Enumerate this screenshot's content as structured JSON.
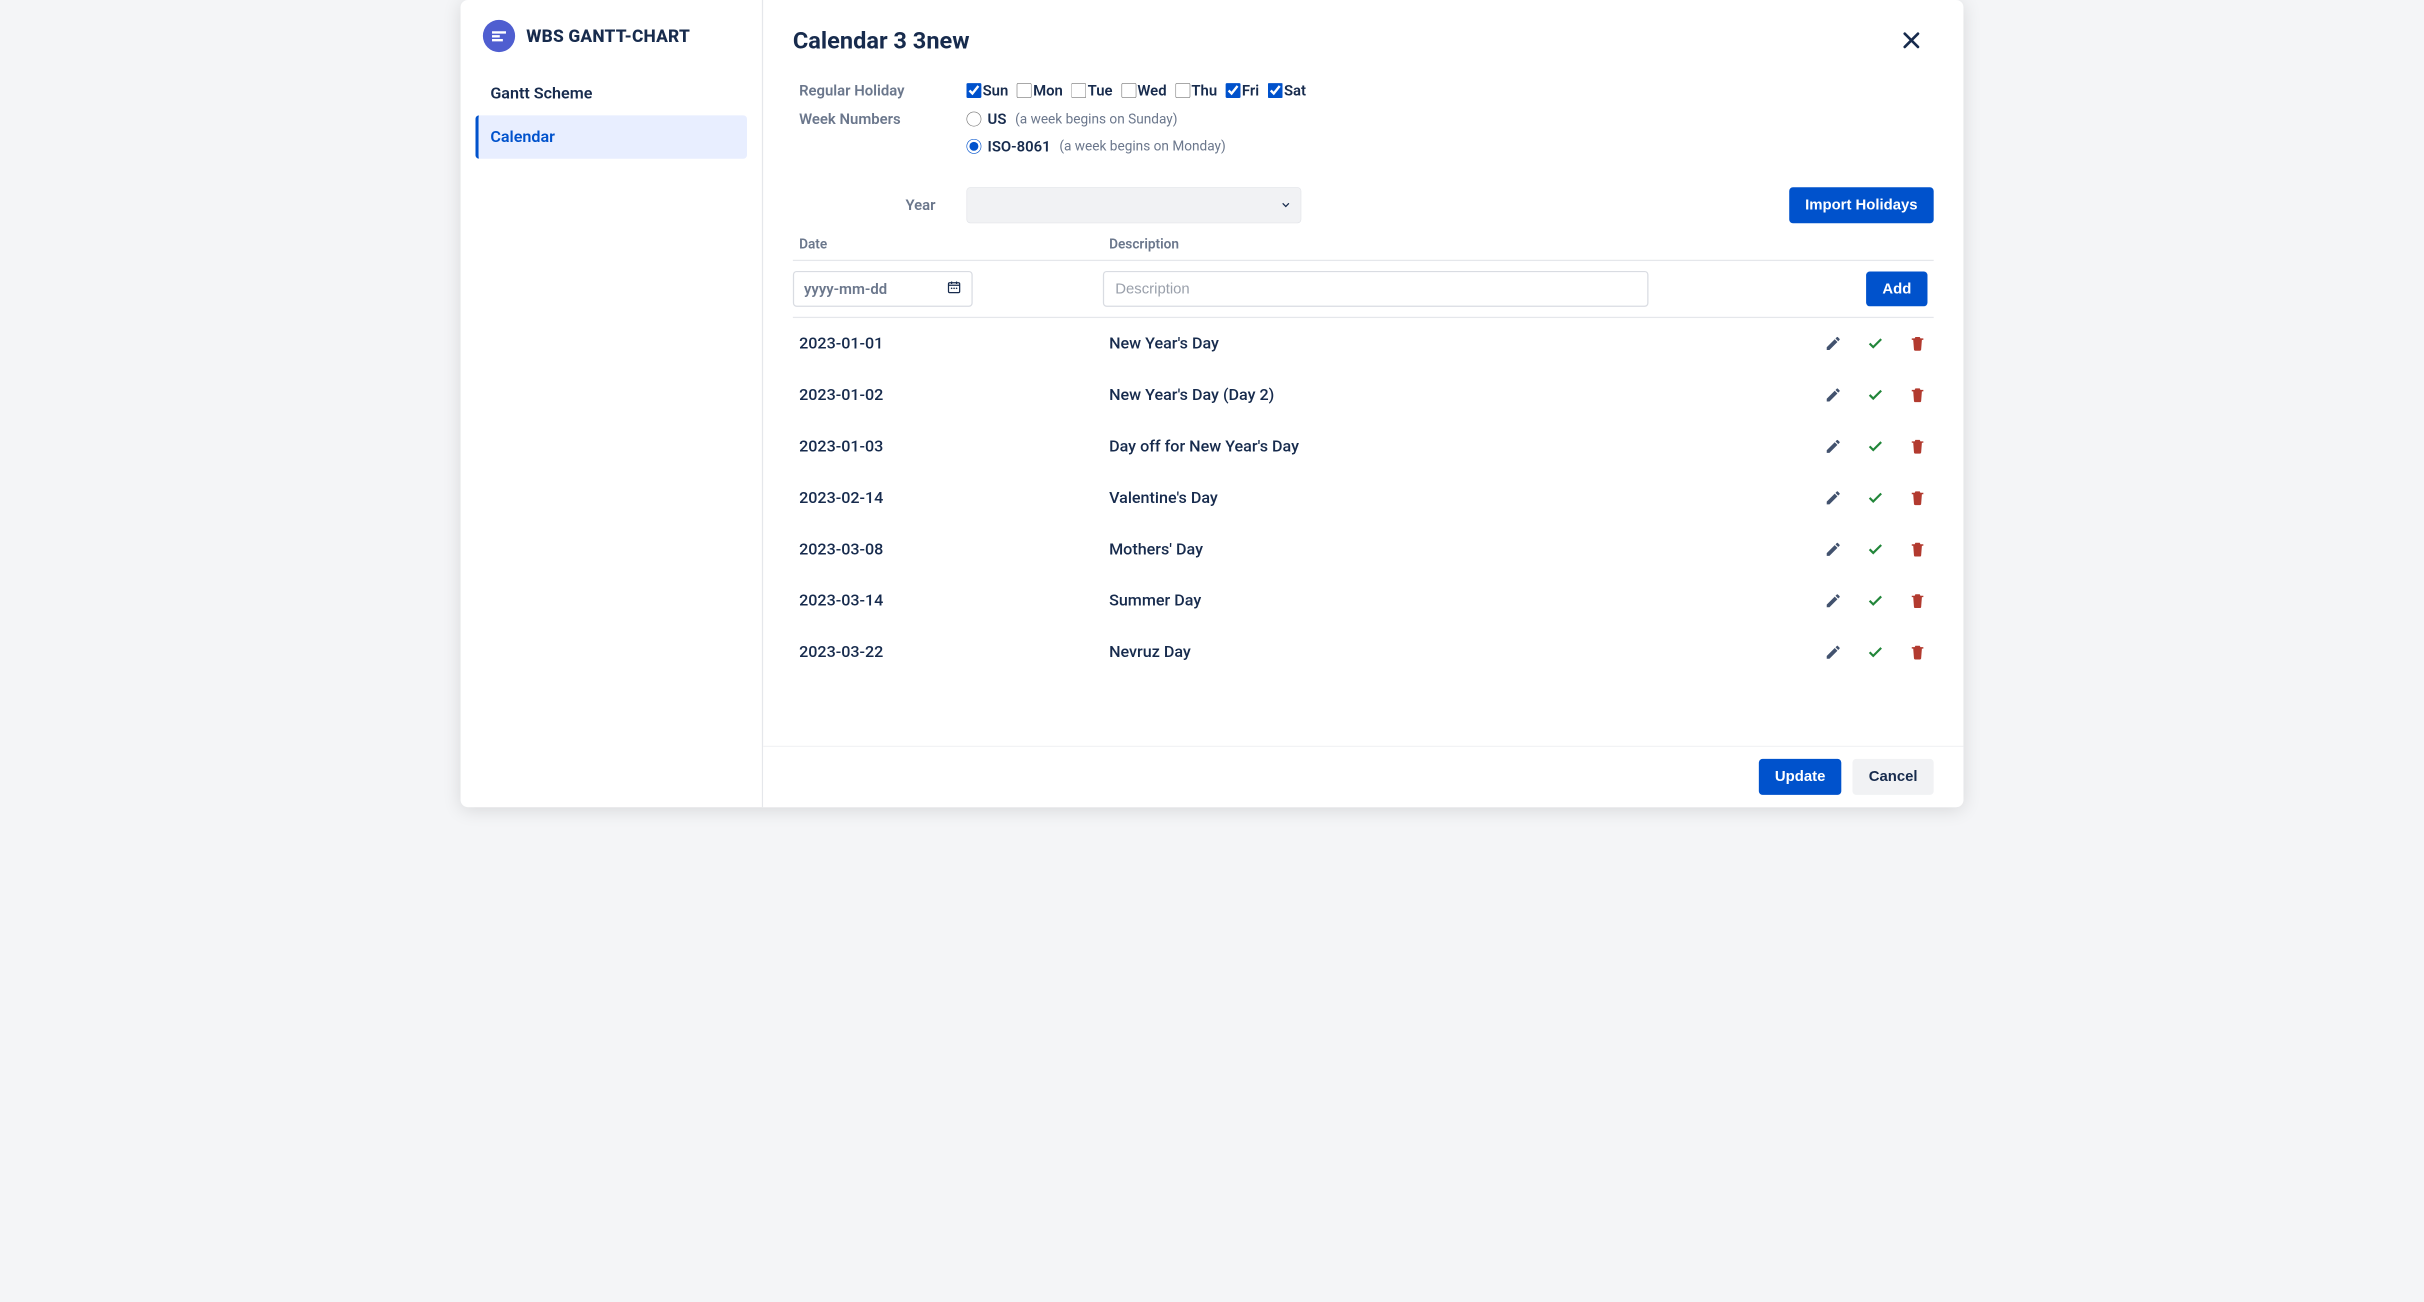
{
  "brand": {
    "title": "WBS GANTT-CHART"
  },
  "sidebar": {
    "items": [
      {
        "label": "Gantt Scheme",
        "active": false
      },
      {
        "label": "Calendar",
        "active": true
      }
    ]
  },
  "page": {
    "title": "Calendar 3 3new"
  },
  "form": {
    "regular_holiday_label": "Regular Holiday",
    "days": [
      {
        "label": "Sun",
        "checked": true
      },
      {
        "label": "Mon",
        "checked": false
      },
      {
        "label": "Tue",
        "checked": false
      },
      {
        "label": "Wed",
        "checked": false
      },
      {
        "label": "Thu",
        "checked": false
      },
      {
        "label": "Fri",
        "checked": true
      },
      {
        "label": "Sat",
        "checked": true
      }
    ],
    "week_numbers_label": "Week Numbers",
    "week_options": [
      {
        "label": "US",
        "hint": "(a week begins on Sunday)",
        "checked": false
      },
      {
        "label": "ISO-8061",
        "hint": "(a week begins on Monday)",
        "checked": true
      }
    ],
    "year_label": "Year",
    "import_label": "Import Holidays"
  },
  "table": {
    "headers": {
      "date": "Date",
      "description": "Description"
    },
    "date_placeholder": "yyyy-mm-dd",
    "desc_placeholder": "Description",
    "add_label": "Add",
    "rows": [
      {
        "date": "2023-01-01",
        "desc": "New Year's Day"
      },
      {
        "date": "2023-01-02",
        "desc": "New Year's Day (Day 2)"
      },
      {
        "date": "2023-01-03",
        "desc": "Day off for New Year's Day"
      },
      {
        "date": "2023-02-14",
        "desc": "Valentine's Day"
      },
      {
        "date": "2023-03-08",
        "desc": "Mothers' Day"
      },
      {
        "date": "2023-03-14",
        "desc": "Summer Day"
      },
      {
        "date": "2023-03-22",
        "desc": "Nevruz Day"
      }
    ]
  },
  "footer": {
    "update": "Update",
    "cancel": "Cancel"
  }
}
